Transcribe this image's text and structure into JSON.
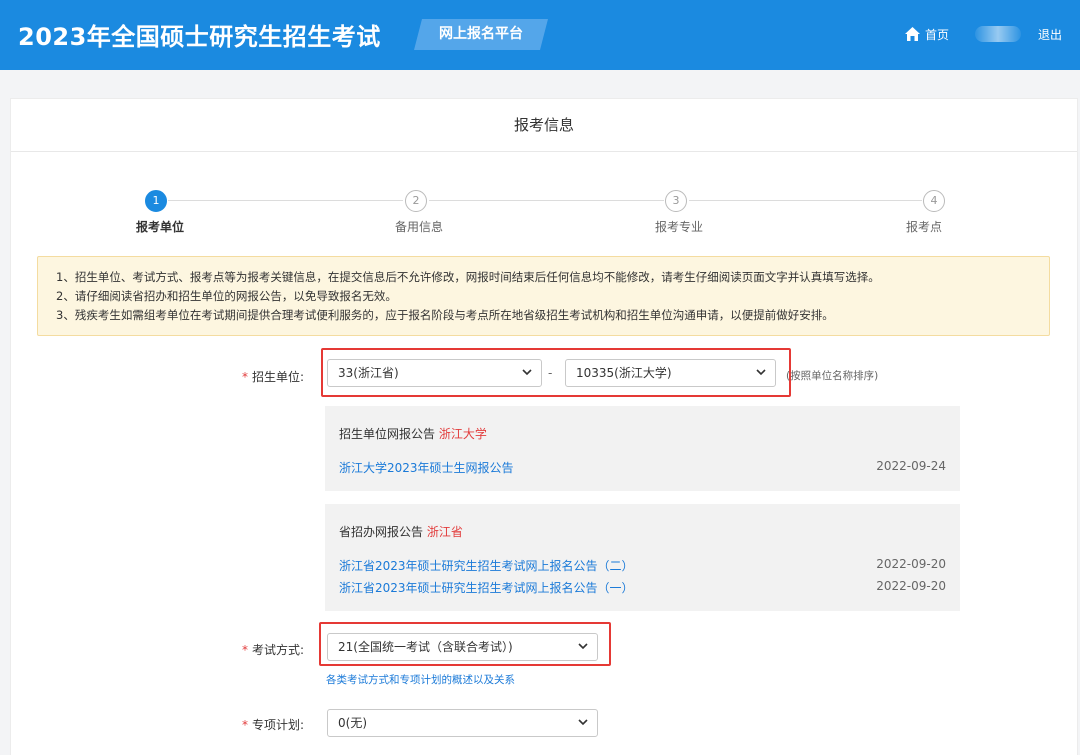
{
  "header": {
    "title": "2023年全国硕士研究生招生考试",
    "platform": "网上报名平台",
    "home": "首页",
    "logout": "退出"
  },
  "card": {
    "title": "报考信息"
  },
  "steps": [
    {
      "num": "1",
      "label": "报考单位"
    },
    {
      "num": "2",
      "label": "备用信息"
    },
    {
      "num": "3",
      "label": "报考专业"
    },
    {
      "num": "4",
      "label": "报考点"
    }
  ],
  "notice": [
    "1、招生单位、考试方式、报考点等为报考关键信息，在提交信息后不允许修改，网报时间结束后任何信息均不能修改，请考生仔细阅读页面文字并认真填写选择。",
    "2、请仔细阅读省招办和招生单位的网报公告，以免导致报名无效。",
    "3、残疾考生如需组考单位在考试期间提供合理考试便利服务的，应于报名阶段与考点所在地省级招生考试机构和招生单位沟通申请，以便提前做好安排。"
  ],
  "form": {
    "required_mark": "*",
    "unit": {
      "label": "招生单位:",
      "province": "33(浙江省)",
      "school": "10335(浙江大学)",
      "separator": "-",
      "hint": "(按照单位名称排序)"
    },
    "exam_mode": {
      "label": "考试方式:",
      "value": "21(全国统一考试（含联合考试）)",
      "link": "各类考试方式和专项计划的概述以及关系"
    },
    "special_plan": {
      "label": "专项计划:",
      "value": "0(无)"
    }
  },
  "school_notice": {
    "title": "招生单位网报公告",
    "highlight": "浙江大学",
    "items": [
      {
        "text": "浙江大学2023年硕士生网报公告",
        "date": "2022-09-24"
      }
    ]
  },
  "province_notice": {
    "title": "省招办网报公告",
    "highlight": "浙江省",
    "items": [
      {
        "text": "浙江省2023年硕士研究生招生考试网上报名公告（二）",
        "date": "2022-09-20"
      },
      {
        "text": "浙江省2023年硕士研究生招生考试网上报名公告（一）",
        "date": "2022-09-20"
      }
    ]
  },
  "colors": {
    "brand": "#1b8ae0",
    "required": "#e23c3c",
    "highlight_box": "#e53935",
    "link": "#1b7ad8"
  }
}
